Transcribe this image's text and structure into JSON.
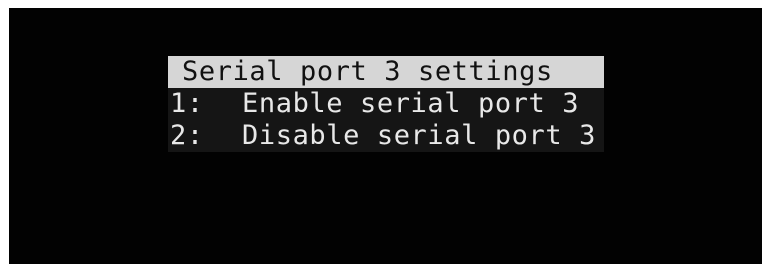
{
  "colors": {
    "screen_background": "#020202",
    "title_background": "#d6d6d6",
    "title_text": "#111111",
    "item_background": "#151515",
    "item_text": "#e8e8e8"
  },
  "menu": {
    "title": "Serial port 3 settings",
    "items": [
      {
        "key": "1:",
        "label": "Enable serial port 3"
      },
      {
        "key": "2:",
        "label": "Disable serial port 3"
      }
    ]
  }
}
